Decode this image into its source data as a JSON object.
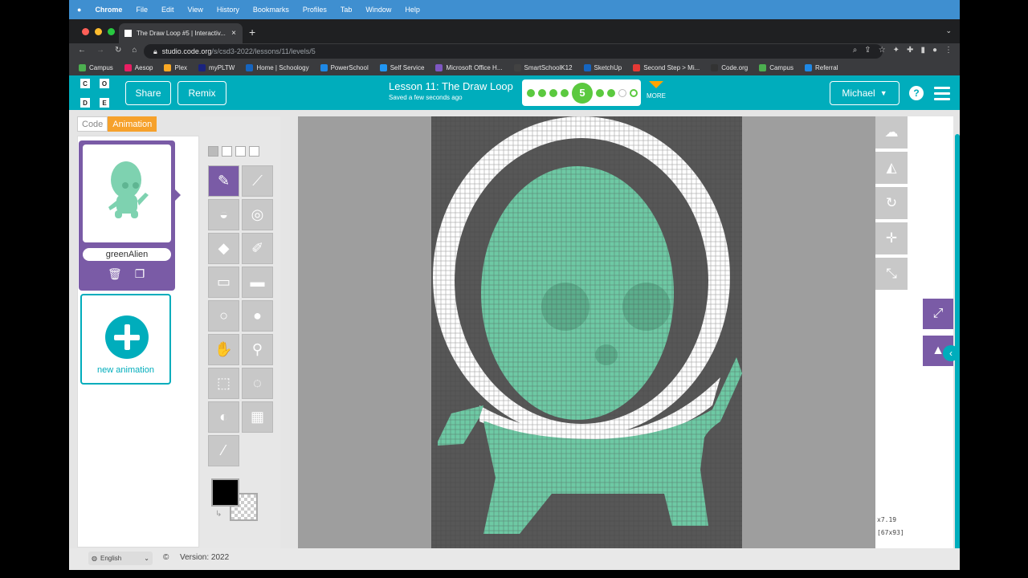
{
  "menubar": {
    "apple": "",
    "app": "Chrome",
    "items": [
      "File",
      "Edit",
      "View",
      "History",
      "Bookmarks",
      "Profiles",
      "Tab",
      "Window",
      "Help"
    ]
  },
  "tab": {
    "title": "The Draw Loop #5 | Interactiv...",
    "close": "×",
    "new": "+",
    "chevron": "⌄"
  },
  "address": {
    "host": "studio.code.org",
    "path": "/s/csd3-2022/lessons/11/levels/5"
  },
  "bookmarks": [
    {
      "label": "Campus",
      "color": "#4caf50"
    },
    {
      "label": "Aesop",
      "color": "#e91e63"
    },
    {
      "label": "Plex",
      "color": "#f9a825"
    },
    {
      "label": "myPLTW",
      "color": "#1a237e"
    },
    {
      "label": "Home | Schoology",
      "color": "#1565c0"
    },
    {
      "label": "PowerSchool",
      "color": "#1e88e5"
    },
    {
      "label": "Self Service",
      "color": "#2196f3"
    },
    {
      "label": "Microsoft Office H...",
      "color": "#7e57c2"
    },
    {
      "label": "SmartSchoolK12",
      "color": "#424242"
    },
    {
      "label": "SketchUp",
      "color": "#1565c0"
    },
    {
      "label": "Second Step > Mi...",
      "color": "#e53935"
    },
    {
      "label": "Code.org",
      "color": "#333333"
    },
    {
      "label": "Campus",
      "color": "#4caf50"
    },
    {
      "label": "Referral",
      "color": "#1e88e5"
    }
  ],
  "header": {
    "logo_letters": [
      "C",
      "O",
      "D",
      "E"
    ],
    "share": "Share",
    "remix": "Remix",
    "lesson_title": "Lesson 11: The Draw Loop",
    "saved": "Saved a few seconds ago",
    "current_level": "5",
    "more": "MORE",
    "user": "Michael",
    "help": "?"
  },
  "modes": {
    "code": "Code",
    "animation": "Animation"
  },
  "animations": {
    "name": "greenAlien",
    "new_label": "new animation"
  },
  "readout": {
    "zoom": "x7.19",
    "size": "[67x93]"
  },
  "footer": {
    "language": "English",
    "copyright": "©",
    "version": "Version: 2022"
  },
  "colors": {
    "accent": "#00adbc",
    "purple": "#7a5ba6",
    "orange": "#f6a12b",
    "alien": "#6ec9a4",
    "progress": "#5bc93f"
  }
}
